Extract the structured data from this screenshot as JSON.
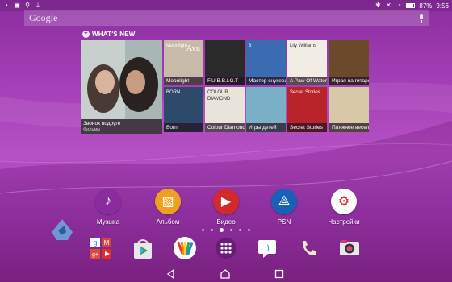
{
  "statusbar": {
    "time": "9:56",
    "battery": "87%",
    "left_icons": [
      "notification-icon",
      "image-icon",
      "usb-icon",
      "download-icon"
    ]
  },
  "search": {
    "placeholder": "Google"
  },
  "whats_new": {
    "title": "WHAT'S NEW",
    "featured": {
      "title": "Звонок подруге",
      "subtitle": "Фильмы"
    },
    "tiles": [
      {
        "label": "Moonlight",
        "art_text": "Moonlight",
        "art_text2": "Ava",
        "bg": "#c9b9a8"
      },
      {
        "label": "F.U.B.B.I.G.T",
        "art_text": "",
        "bg": "#2a2a2a"
      },
      {
        "label": "Мастер снукера",
        "art_text": "8",
        "bg": "#3b6bb0"
      },
      {
        "label": "A Paw Of Water",
        "art_text": "Lily Williams",
        "bg": "#f2ede4"
      },
      {
        "label": "Играя на гитаре",
        "art_text": "",
        "bg": "#6a4a2a"
      },
      {
        "label": "Born",
        "art_text": "BORN",
        "bg": "#2e4a6a"
      },
      {
        "label": "Colour Diamond",
        "art_text": "COLOUR DIAMOND",
        "bg": "#e8e4da"
      },
      {
        "label": "Игры детей",
        "art_text": "",
        "bg": "#7ab0c8"
      },
      {
        "label": "Secret Stories",
        "art_text": "Secret Stories",
        "bg": "#b8242a"
      },
      {
        "label": "Пляжное весел.",
        "art_text": "",
        "bg": "#d8c8a8"
      }
    ]
  },
  "apps": [
    {
      "label": "Музыка",
      "icon": "music-icon",
      "color": "#8a2ca0"
    },
    {
      "label": "Альбом",
      "icon": "album-icon",
      "color": "#f0a020"
    },
    {
      "label": "Видео",
      "icon": "video-icon",
      "color": "#d22a2a"
    },
    {
      "label": "PSN",
      "icon": "psn-icon",
      "color": "#1a5fb8"
    },
    {
      "label": "Настройки",
      "icon": "settings-icon",
      "color": "#e02828"
    }
  ],
  "pager": {
    "pages": 6,
    "active": 3
  },
  "dock": [
    "google-apps-folder-icon",
    "play-store-icon",
    "sketch-icon",
    "app-drawer-icon",
    "messaging-icon",
    "phone-icon",
    "camera-icon"
  ],
  "nav": [
    "back-icon",
    "home-icon",
    "recents-icon"
  ],
  "colors": {
    "accent": "#a43fb6"
  }
}
